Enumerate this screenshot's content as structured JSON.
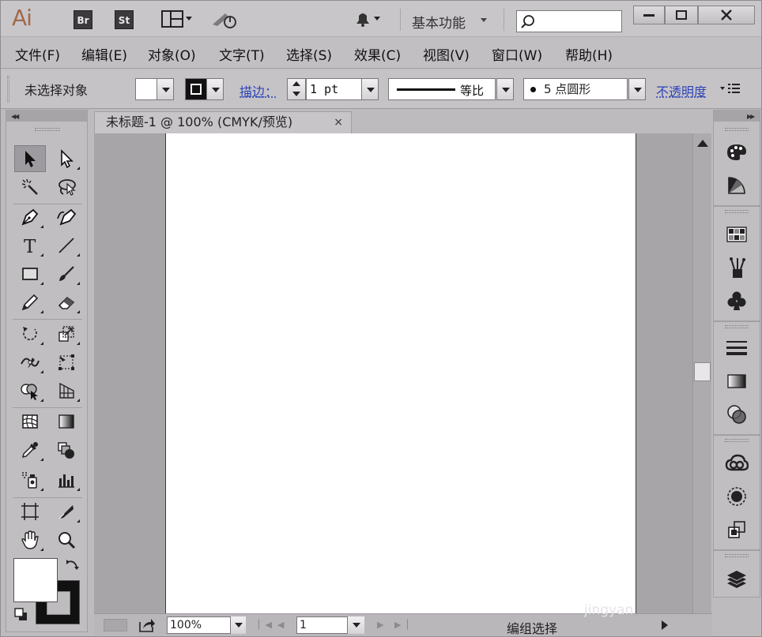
{
  "titlebar": {
    "logo": "Ai",
    "bridge": "Br",
    "stock": "St",
    "workspace": "基本功能",
    "search_placeholder": ""
  },
  "menu": [
    "文件(F)",
    "编辑(E)",
    "对象(O)",
    "文字(T)",
    "选择(S)",
    "效果(C)",
    "视图(V)",
    "窗口(W)",
    "帮助(H)"
  ],
  "control": {
    "selection": "未选择对象",
    "stroke_label": "描边：",
    "stroke_weight": "1 pt",
    "profile_label": "等比",
    "brush_label": "5 点圆形",
    "opacity_label": "不透明度"
  },
  "document": {
    "tab_title": "未标题-1 @ 100% (CMYK/预览)",
    "tab_close": "×"
  },
  "status": {
    "zoom": "100%",
    "page": "1",
    "message": "编组选择"
  },
  "watermark": "jingyan",
  "colors": {
    "logo": "#a06a49",
    "link": "#2e45b8",
    "artboard": "#ffffff",
    "pasteboard": "#a8a5a9"
  }
}
